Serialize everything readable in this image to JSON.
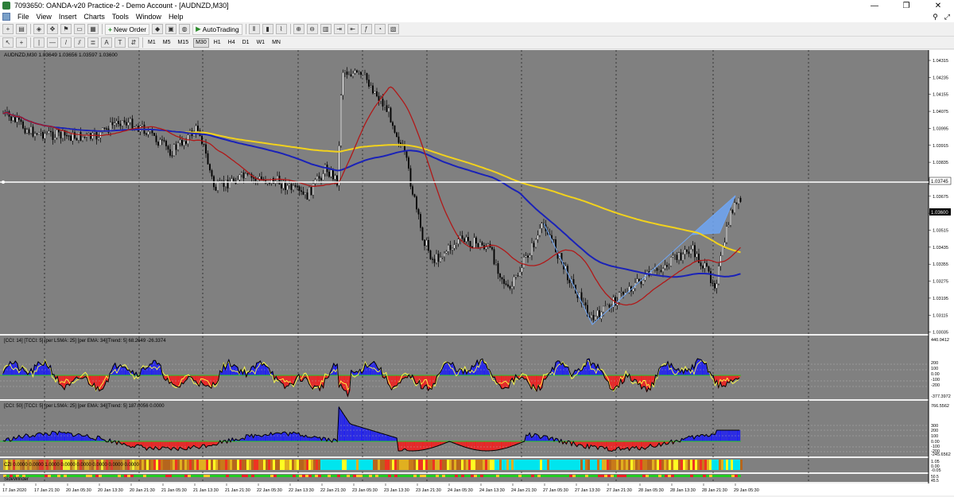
{
  "window": {
    "title": "7093650: OANDA-v20 Practice-2 - Demo Account - [AUDNZD,M30]",
    "minimize": "—",
    "restore": "❐",
    "close": "✕"
  },
  "menu": {
    "items": [
      "File",
      "View",
      "Insert",
      "Charts",
      "Tools",
      "Window",
      "Help"
    ],
    "search_icon": "search-icon",
    "fullscreen_icon": "fullscreen-icon"
  },
  "toolbar1": {
    "new_order_label": "New Order",
    "autotrading_label": "AutoTrading"
  },
  "toolbar2": {
    "timeframes": [
      "M1",
      "M5",
      "M15",
      "M30",
      "H1",
      "H4",
      "D1",
      "W1",
      "MN"
    ],
    "active_timeframe": "M30"
  },
  "chart": {
    "header": "AUDNZD,M30  1.03649 1.03656 1.03597 1.03600",
    "price_labels": [
      "1.04315",
      "1.04235",
      "1.04155",
      "1.04075",
      "1.03995",
      "1.03915",
      "1.03835",
      "1.03745",
      "1.03675",
      "1.03600",
      "1.03515",
      "1.03435",
      "1.03355",
      "1.03275",
      "1.03195",
      "1.03115",
      "1.03035"
    ],
    "horizontal_line_label": "1.03745",
    "current_price_label": "1.03600",
    "date_labels": [
      "17 Jan 2020",
      "17 Jan 21:30",
      "20 Jan 05:30",
      "20 Jan 13:30",
      "20 Jan 21:30",
      "21 Jan 05:30",
      "21 Jan 13:30",
      "21 Jan 21:30",
      "22 Jan 05:30",
      "22 Jan 13:30",
      "22 Jan 21:30",
      "23 Jan 05:30",
      "23 Jan 13:30",
      "23 Jan 21:30",
      "24 Jan 05:30",
      "24 Jan 13:30",
      "24 Jan 21:30",
      "27 Jan 05:30",
      "27 Jan 13:30",
      "27 Jan 21:30",
      "28 Jan 05:30",
      "28 Jan 13:30",
      "28 Jan 21:30",
      "29 Jan 05:30"
    ]
  },
  "indicator1": {
    "header": "[CCI: 14] [TCCI: 5] [per LSMA: 25] [per EMA: 34][Trend: 5]  68.2649 -26.3374",
    "labels": [
      "440.0412",
      "200",
      "100",
      "0.00",
      "-100",
      "-200",
      "-377.3972"
    ]
  },
  "indicator2": {
    "header": "[CCI: 50] [TCCI: 5] [per LSMA: 25] [per EMA: 34][Trend: 5]  187.0056 0.0000",
    "labels": [
      "766.5562",
      "300",
      "200",
      "100",
      "0.00",
      "-100",
      "-200",
      "-245.6562"
    ]
  },
  "indicator3": {
    "header": "CZI 0.0000 0.0000 1.0000 0.0000 0.0000 0.0000 0.0000 0.0000",
    "labels": [
      "1.05",
      "0.00",
      "-0.05"
    ]
  },
  "indicator4": {
    "header": "SideWinder",
    "labels": [
      "50.5",
      "45.5"
    ]
  },
  "colors": {
    "chart_bg": "#808080",
    "candles": "#000000",
    "ma_red": "#b01818",
    "ma_blue": "#1a22b8",
    "ma_yellow": "#f2d21c",
    "pattern_fill": "#6fa6f5",
    "cci_up": "#2222ee",
    "cci_down": "#ee2222",
    "cci_signal": "#ffff44",
    "czi_cyan": "#00e5ee",
    "czi_brown": "#b5651d"
  }
}
